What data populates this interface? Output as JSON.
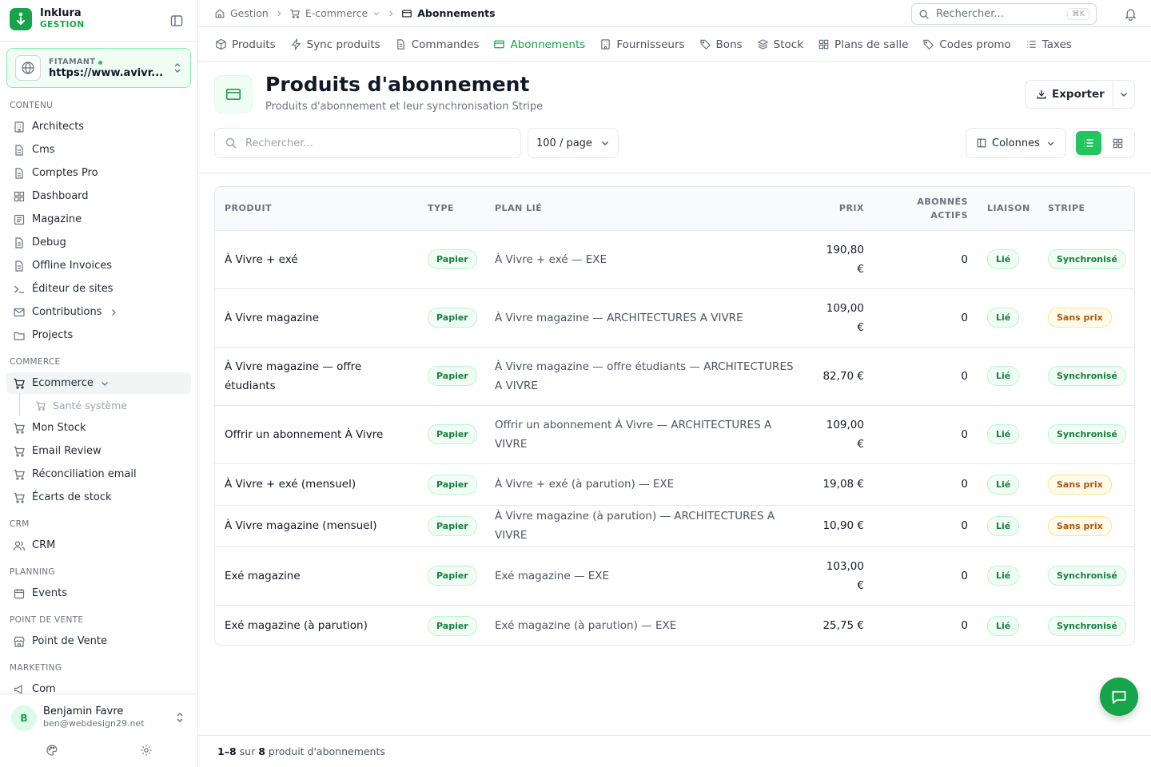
{
  "brand": {
    "name": "Inklura",
    "sub": "GESTION"
  },
  "site": {
    "label": "FITAMANT",
    "url": "https://www.avivre.fr",
    "url_display": "https://www.avivr..."
  },
  "sidebar": {
    "sections": {
      "contenu": "CONTENU",
      "commerce": "COMMERCE",
      "crm": "CRM",
      "planning": "PLANNING",
      "pos": "POINT DE VENTE",
      "marketing": "MARKETING"
    },
    "items": {
      "architects": "Architects",
      "cms": "Cms",
      "comptes_pro": "Comptes Pro",
      "dashboard": "Dashboard",
      "magazine": "Magazine",
      "debug": "Debug",
      "offline_invoices": "Offline Invoices",
      "editeur": "Éditeur de sites",
      "contributions": "Contributions",
      "projects": "Projects",
      "ecommerce": "Ecommerce",
      "sante": "Santé système",
      "stock": "Mon Stock",
      "email_review": "Email Review",
      "reconciliation": "Réconciliation email",
      "ecarts": "Écarts de stock",
      "crm": "CRM",
      "events": "Events",
      "pos": "Point de Vente",
      "com": "Com"
    }
  },
  "user": {
    "initial": "B",
    "name": "Benjamin Favre",
    "email": "ben@webdesign29.net"
  },
  "breadcrumb": {
    "gestion": "Gestion",
    "ecommerce": "E-commerce",
    "current": "Abonnements"
  },
  "top_search": {
    "placeholder": "Rechercher...",
    "shortcut": "⌘K"
  },
  "tabs": {
    "produits": "Produits",
    "sync": "Sync produits",
    "commandes": "Commandes",
    "abonnements": "Abonnements",
    "fournisseurs": "Fournisseurs",
    "bons": "Bons",
    "stock": "Stock",
    "plans": "Plans de salle",
    "codes": "Codes promo",
    "taxes": "Taxes"
  },
  "page": {
    "title": "Produits d'abonnement",
    "subtitle": "Produits d'abonnement et leur synchronisation Stripe",
    "export": "Exporter",
    "search_placeholder": "Rechercher...",
    "per_page": "100 / page",
    "columns": "Colonnes"
  },
  "table": {
    "headers": {
      "produit": "PRODUIT",
      "type": "TYPE",
      "plan": "PLAN LIÉ",
      "prix": "PRIX",
      "abonnes": "ABONNÉS ACTIFS",
      "liaison": "LIAISON",
      "stripe": "STRIPE"
    },
    "rows": [
      {
        "produit": "À Vivre + exé",
        "type": "Papier",
        "plan": "À Vivre + exé — EXE",
        "prix": "190,80 €",
        "abonnes": "0",
        "liaison": "Lié",
        "stripe": "Synchronisé",
        "stripe_status": "ok"
      },
      {
        "produit": "À Vivre magazine",
        "type": "Papier",
        "plan": "À Vivre magazine — ARCHITECTURES A VIVRE",
        "prix": "109,00 €",
        "abonnes": "0",
        "liaison": "Lié",
        "stripe": "Sans prix",
        "stripe_status": "warn"
      },
      {
        "produit": "À Vivre magazine — offre étudiants",
        "type": "Papier",
        "plan": "À Vivre magazine — offre étudiants — ARCHITECTURES A VIVRE",
        "prix": "82,70 €",
        "abonnes": "0",
        "liaison": "Lié",
        "stripe": "Synchronisé",
        "stripe_status": "ok"
      },
      {
        "produit": "Offrir un abonnement À Vivre",
        "type": "Papier",
        "plan": "Offrir un abonnement À Vivre — ARCHITECTURES A VIVRE",
        "prix": "109,00 €",
        "abonnes": "0",
        "liaison": "Lié",
        "stripe": "Synchronisé",
        "stripe_status": "ok"
      },
      {
        "produit": "À Vivre + exé (mensuel)",
        "type": "Papier",
        "plan": "À Vivre + exé (à parution) — EXE",
        "prix": "19,08 €",
        "abonnes": "0",
        "liaison": "Lié",
        "stripe": "Sans prix",
        "stripe_status": "warn"
      },
      {
        "produit": "À Vivre magazine (mensuel)",
        "type": "Papier",
        "plan": "À Vivre magazine (à parution) — ARCHITECTURES A VIVRE",
        "prix": "10,90 €",
        "abonnes": "0",
        "liaison": "Lié",
        "stripe": "Sans prix",
        "stripe_status": "warn"
      },
      {
        "produit": "Exé magazine",
        "type": "Papier",
        "plan": "Exé magazine — EXE",
        "prix": "103,00 €",
        "abonnes": "0",
        "liaison": "Lié",
        "stripe": "Synchronisé",
        "stripe_status": "ok"
      },
      {
        "produit": "Exé magazine (à parution)",
        "type": "Papier",
        "plan": "Exé magazine (à parution) — EXE",
        "prix": "25,75 €",
        "abonnes": "0",
        "liaison": "Lié",
        "stripe": "Synchronisé",
        "stripe_status": "ok"
      }
    ]
  },
  "footer": {
    "range": "1–8",
    "sur": "sur",
    "total": "8",
    "label": "produit d'abonnements"
  },
  "colors": {
    "accent": "#16a34a",
    "accent_light": "#22c55e",
    "warn": "#b45309"
  }
}
